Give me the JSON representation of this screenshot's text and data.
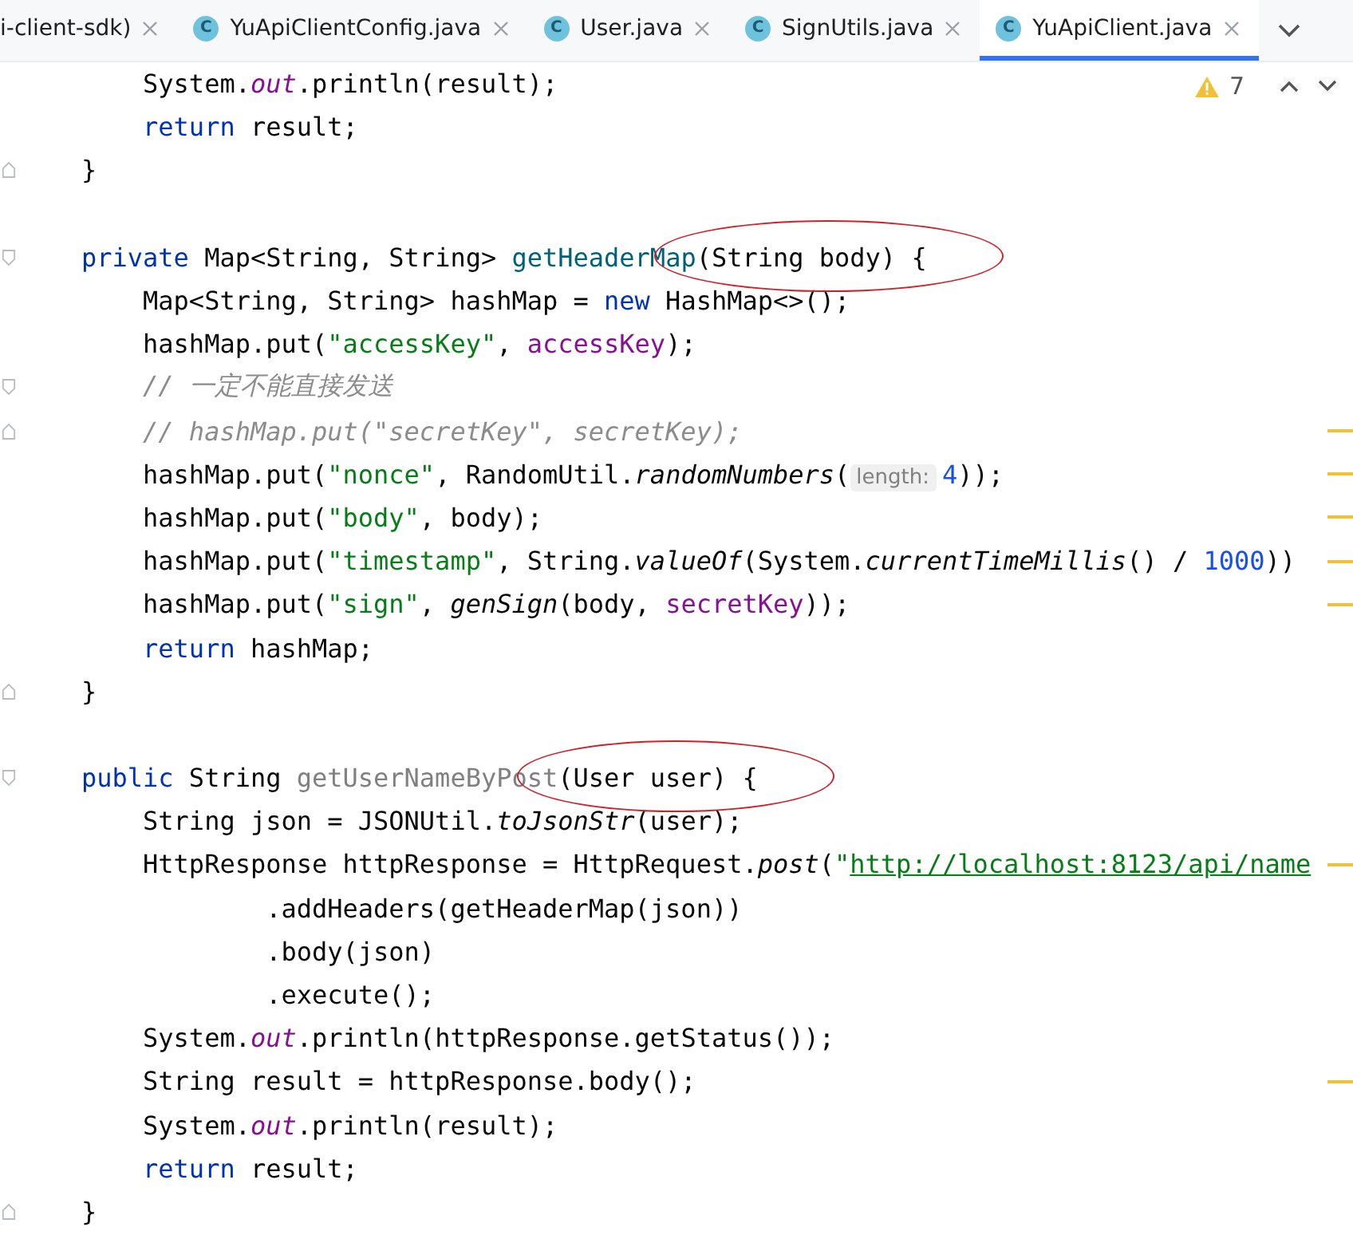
{
  "tabs": [
    {
      "label": "i-client-sdk)",
      "selected": false
    },
    {
      "label": "YuApiClientConfig.java",
      "icon": "C",
      "selected": false
    },
    {
      "label": "User.java",
      "icon": "C",
      "selected": false
    },
    {
      "label": "SignUtils.java",
      "icon": "C",
      "selected": false
    },
    {
      "label": "YuApiClient.java",
      "icon": "C",
      "selected": true
    }
  ],
  "inspections": {
    "warnings": "7"
  },
  "code_lines": [
    {
      "kind": "plain",
      "marker": false,
      "tokens": [
        {
          "t": "    System.",
          "kind": "plain"
        },
        {
          "t": "out",
          "kind": "static_field"
        },
        {
          "t": ".println(result);",
          "kind": "plain"
        }
      ]
    },
    {
      "kind": "plain",
      "marker": false,
      "tokens": [
        {
          "t": "    return",
          "kind": "keyword"
        },
        {
          "t": " result;",
          "kind": "plain"
        }
      ]
    },
    {
      "kind": "fold_end",
      "marker": false,
      "tokens": [
        {
          "t": "}",
          "kind": "plain"
        }
      ]
    },
    {
      "kind": "plain",
      "marker": false
    },
    {
      "kind": "fold_start",
      "marker": false,
      "tokens": [
        {
          "t": "private",
          "kind": "keyword"
        },
        {
          "t": " Map<String, String> ",
          "kind": "plain"
        },
        {
          "t": "getHeaderMap",
          "kind": "method_decl"
        },
        {
          "t": "(String body) {",
          "kind": "plain",
          "circled": true
        }
      ]
    },
    {
      "kind": "plain",
      "marker": false,
      "tokens": [
        {
          "t": "    Map<String, String> hashMap = ",
          "kind": "plain"
        },
        {
          "t": "new",
          "kind": "keyword"
        },
        {
          "t": " HashMap<>();",
          "kind": "plain"
        }
      ]
    },
    {
      "kind": "plain",
      "marker": false,
      "tokens": [
        {
          "t": "    hashMap.put(",
          "kind": "plain"
        },
        {
          "t": "\"accessKey\"",
          "kind": "string"
        },
        {
          "t": ", ",
          "kind": "plain"
        },
        {
          "t": "accessKey",
          "kind": "field"
        },
        {
          "t": ");",
          "kind": "plain"
        }
      ]
    },
    {
      "kind": "fold_start",
      "marker": false,
      "tokens": [
        {
          "t": "    // 一定不能直接发送",
          "kind": "comment"
        }
      ]
    },
    {
      "kind": "fold_end",
      "marker": true,
      "tokens": [
        {
          "t": "    // hashMap.put(\"secretKey\", secretKey);",
          "kind": "comment"
        }
      ]
    },
    {
      "kind": "plain",
      "marker": true,
      "tokens": [
        {
          "t": "    hashMap.put(",
          "kind": "plain"
        },
        {
          "t": "\"nonce\"",
          "kind": "string"
        },
        {
          "t": ", RandomUtil.",
          "kind": "plain"
        },
        {
          "t": "randomNumbers",
          "kind": "static_method"
        },
        {
          "t": "(",
          "kind": "plain"
        },
        {
          "t": "length:",
          "kind": "hint"
        },
        {
          "t": "4",
          "kind": "number"
        },
        {
          "t": "));",
          "kind": "plain"
        }
      ]
    },
    {
      "kind": "plain",
      "marker": true,
      "tokens": [
        {
          "t": "    hashMap.put(",
          "kind": "plain"
        },
        {
          "t": "\"body\"",
          "kind": "string"
        },
        {
          "t": ", body);",
          "kind": "plain"
        }
      ]
    },
    {
      "kind": "plain",
      "marker": true,
      "tokens": [
        {
          "t": "    hashMap.put(",
          "kind": "plain"
        },
        {
          "t": "\"timestamp\"",
          "kind": "string"
        },
        {
          "t": ", String.",
          "kind": "plain"
        },
        {
          "t": "valueOf",
          "kind": "static_method"
        },
        {
          "t": "(System.",
          "kind": "plain"
        },
        {
          "t": "currentTimeMillis",
          "kind": "static_method"
        },
        {
          "t": "() / ",
          "kind": "plain"
        },
        {
          "t": "1000",
          "kind": "number"
        },
        {
          "t": "))",
          "kind": "plain"
        }
      ]
    },
    {
      "kind": "plain",
      "marker": true,
      "tokens": [
        {
          "t": "    hashMap.put(",
          "kind": "plain"
        },
        {
          "t": "\"sign\"",
          "kind": "string"
        },
        {
          "t": ", ",
          "kind": "plain"
        },
        {
          "t": "genSign",
          "kind": "static_method"
        },
        {
          "t": "(body, ",
          "kind": "plain"
        },
        {
          "t": "secretKey",
          "kind": "field"
        },
        {
          "t": "));",
          "kind": "plain"
        }
      ]
    },
    {
      "kind": "plain",
      "marker": false,
      "tokens": [
        {
          "t": "    return",
          "kind": "keyword"
        },
        {
          "t": " hashMap;",
          "kind": "plain"
        }
      ]
    },
    {
      "kind": "fold_end",
      "marker": false,
      "tokens": [
        {
          "t": "}",
          "kind": "plain"
        }
      ]
    },
    {
      "kind": "plain",
      "marker": false
    },
    {
      "kind": "fold_start",
      "marker": false,
      "tokens": [
        {
          "t": "public",
          "kind": "keyword"
        },
        {
          "t": " String ",
          "kind": "plain"
        },
        {
          "t": "getUserNameByPost",
          "kind": "unused"
        },
        {
          "t": "(User user) {",
          "kind": "plain",
          "circled": true
        }
      ]
    },
    {
      "kind": "plain",
      "marker": false,
      "tokens": [
        {
          "t": "    String json = JSONUtil.",
          "kind": "plain"
        },
        {
          "t": "toJsonStr",
          "kind": "static_method"
        },
        {
          "t": "(user);",
          "kind": "plain"
        }
      ]
    },
    {
      "kind": "plain",
      "marker": true,
      "tokens": [
        {
          "t": "    HttpResponse httpResponse = HttpRequest.",
          "kind": "plain"
        },
        {
          "t": "post",
          "kind": "static_method"
        },
        {
          "t": "(",
          "kind": "plain"
        },
        {
          "t": "\"",
          "kind": "string"
        },
        {
          "t": "http://localhost:8123/api/name",
          "kind": "link"
        }
      ]
    },
    {
      "kind": "plain",
      "marker": false,
      "tokens": [
        {
          "t": "            .addHeaders(getHeaderMap(json))",
          "kind": "plain"
        }
      ]
    },
    {
      "kind": "plain",
      "marker": false,
      "tokens": [
        {
          "t": "            .body(json)",
          "kind": "plain"
        }
      ]
    },
    {
      "kind": "plain",
      "marker": false,
      "tokens": [
        {
          "t": "            .execute();",
          "kind": "plain"
        }
      ]
    },
    {
      "kind": "plain",
      "marker": false,
      "tokens": [
        {
          "t": "    System.",
          "kind": "plain"
        },
        {
          "t": "out",
          "kind": "static_field"
        },
        {
          "t": ".println(httpResponse.getStatus());",
          "kind": "plain"
        }
      ]
    },
    {
      "kind": "plain",
      "marker": true,
      "tokens": [
        {
          "t": "    String result = httpResponse.body();",
          "kind": "plain"
        }
      ]
    },
    {
      "kind": "plain",
      "marker": false,
      "tokens": [
        {
          "t": "    System.",
          "kind": "plain"
        },
        {
          "t": "out",
          "kind": "static_field"
        },
        {
          "t": ".println(result);",
          "kind": "plain"
        }
      ]
    },
    {
      "kind": "plain",
      "marker": false,
      "tokens": [
        {
          "t": "    return",
          "kind": "keyword"
        },
        {
          "t": " result;",
          "kind": "plain"
        }
      ]
    },
    {
      "kind": "fold_end",
      "marker": false,
      "tokens": [
        {
          "t": "}",
          "kind": "plain"
        }
      ]
    }
  ]
}
